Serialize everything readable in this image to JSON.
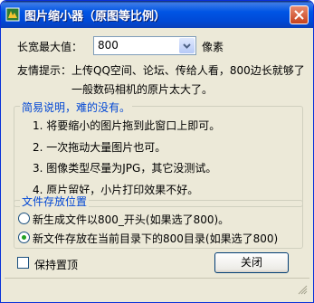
{
  "window": {
    "title": "图片缩小器（原图等比例）"
  },
  "size_row": {
    "label": "长宽最大值：",
    "value": "800",
    "unit": "像素"
  },
  "tip": {
    "line1": "友情提示：上传QQ空间、论坛、传给人看，800边长就够了",
    "line2": "一般数码相机的原片太大了。"
  },
  "info_group": {
    "title": "简易说明，难的没有。",
    "items": [
      "1. 将要缩小的图片拖到此窗口上即可。",
      "2. 一次拖动大量图片也可。",
      "3. 图像类型尽量为JPG，其它没测试。",
      "4. 原片留好，小片打印效果不好。"
    ]
  },
  "save_group": {
    "title": "文件存放位置",
    "option1": "新生成文件以800_开头(如果选了800)。",
    "option2": "新文件存放在当前目录下的800目录(如果选了800)",
    "selected": 2
  },
  "topmost": {
    "label": "保持置顶",
    "checked": false
  },
  "close_button": {
    "label": "关闭"
  },
  "colors": {
    "group_title": "#0046d5",
    "radio_selected": "#21a121",
    "titlebar": "#0055e5"
  }
}
